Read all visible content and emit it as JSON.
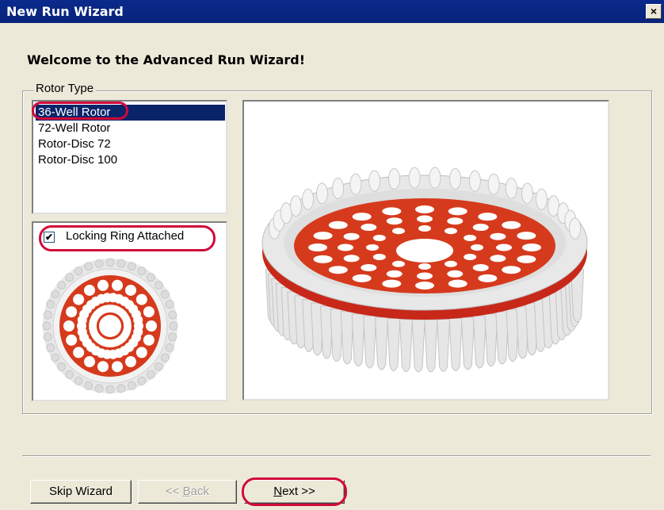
{
  "window": {
    "title": "New Run Wizard",
    "close_label": "×"
  },
  "heading": "Welcome to the Advanced Run Wizard!",
  "rotor_group": {
    "legend": "Rotor Type",
    "items": [
      "36-Well Rotor",
      "72-Well Rotor",
      "Rotor-Disc 72",
      "Rotor-Disc 100"
    ],
    "selected": "36-Well Rotor"
  },
  "locking_ring": {
    "label": "Locking Ring Attached",
    "checked": true,
    "check_glyph": "✔"
  },
  "buttons": {
    "skip": "Skip Wizard",
    "back_prefix": "<< ",
    "back_mnemonic": "B",
    "back_rest": "ack",
    "next_mnemonic": "N",
    "next_rest": "ext >>"
  },
  "colors": {
    "highlight_oval": "#d10a3a",
    "selection": "#0a246a",
    "rotor": "#d63a1c"
  }
}
